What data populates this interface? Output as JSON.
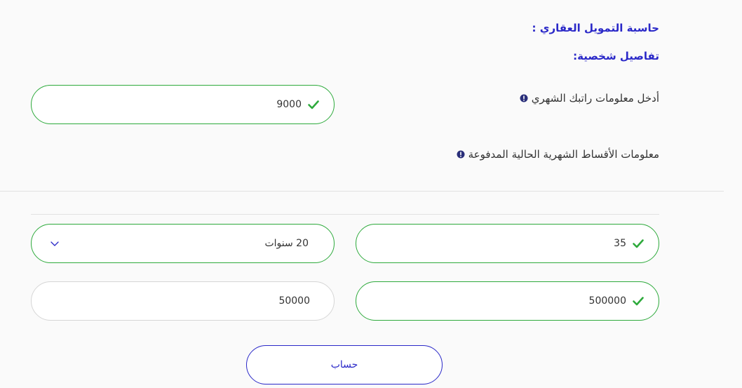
{
  "calculator": {
    "title": "حاسبة التمويل العقاري :",
    "section_title": "تفاصيل شخصية:"
  },
  "salary": {
    "label": "أدخل معلومات راتبك الشهري",
    "value": "9000"
  },
  "installments": {
    "label": "معلومات الأقساط الشهرية الحالية المدفوعة"
  },
  "age": {
    "value": "35"
  },
  "duration": {
    "selected": "20 سنوات"
  },
  "property_price": {
    "value": "500000"
  },
  "down_payment": {
    "value": "50000"
  },
  "actions": {
    "calculate_label": "حساب"
  },
  "colors": {
    "accent": "#2a28c8",
    "valid": "#2eaa3c",
    "info_icon": "#2a2f7a"
  }
}
